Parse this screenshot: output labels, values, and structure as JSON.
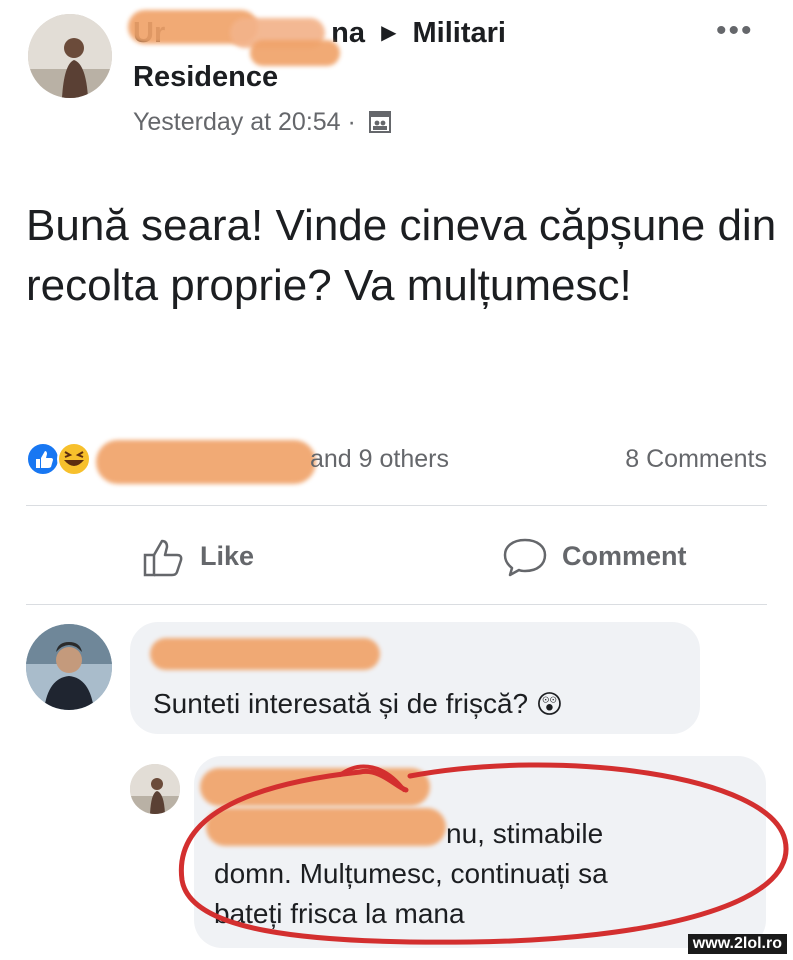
{
  "post": {
    "author_visible_suffix": "na",
    "author_redacted_prefix": "Ur",
    "group_arrow": "▶",
    "group_name_line1": "Militari",
    "group_name_line2": "Residence",
    "timestamp": "Yesterday at 20:54 ·",
    "privacy_icon": "group-privacy-icon",
    "more_label": "•••",
    "text": "Bună seara! Vinde cineva căpșune din recolta proprie? Va mulțumesc!"
  },
  "reactions": {
    "icons": [
      "like-reaction-icon",
      "haha-reaction-icon"
    ],
    "summary_suffix": "and 9 others",
    "comments_count": "8 Comments"
  },
  "actions": {
    "like_label": "Like",
    "comment_label": "Comment"
  },
  "comments": [
    {
      "author_redacted": "",
      "text": "Sunteti interesată și de frișcă?",
      "emoji": "😲"
    },
    {
      "author_redacted": "",
      "text_partial_prefix": "nu, stimabile",
      "text_line2": "domn. Mulțumesc, continuați sa",
      "text_line3": "bateți frisca la mana"
    }
  ],
  "watermark": "www.2lol.ro",
  "colors": {
    "text": "#1c1e21",
    "secondary": "#65676b",
    "bubble": "#f0f2f5",
    "highlight_circle": "#d32f2f",
    "redaction": "#f0a36a",
    "like_blue": "#1877f2"
  }
}
